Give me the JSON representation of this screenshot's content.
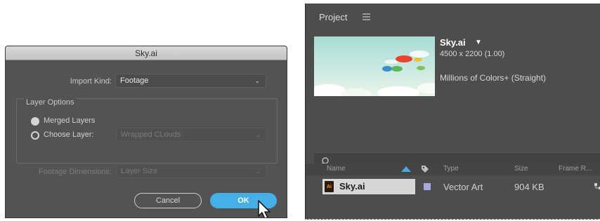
{
  "dialog": {
    "title": "Sky.ai",
    "import_kind": {
      "label": "Import Kind:",
      "value": "Footage"
    },
    "layer_options": {
      "group_label": "Layer Options",
      "merged_layers": "Merged Layers",
      "choose_layer": "Choose Layer:",
      "choose_layer_value": "Wrapped CLouds",
      "selected_option": "merged"
    },
    "footage_dimensions": {
      "label": "Footage Dimensions:",
      "value": "Layer Size"
    },
    "buttons": {
      "cancel": "Cancel",
      "ok": "OK"
    }
  },
  "project_panel": {
    "tab_title": "Project",
    "item": {
      "name": "Sky.ai",
      "dimensions": "4500 x 2200 (1.00)",
      "colors": "Millions of Colors+ (Straight)"
    },
    "columns": [
      "Name",
      "Type",
      "Size",
      "Frame R..."
    ],
    "rows": [
      {
        "name": "Sky.ai",
        "type": "Vector Art",
        "size": "904 KB"
      }
    ]
  },
  "colors": {
    "accent": "#45b0e8",
    "dialog_bg": "#535353",
    "panel_bg": "#4d4d4d",
    "label_swatch": "#a9a9e0"
  },
  "icons": [
    "chevron-down-icon",
    "radio-selected-icon",
    "radio-unselected-icon",
    "mouse-cursor-icon",
    "panel-menu-icon",
    "search-icon",
    "sort-ascending-icon",
    "label-tag-icon",
    "illustrator-file-icon"
  ]
}
